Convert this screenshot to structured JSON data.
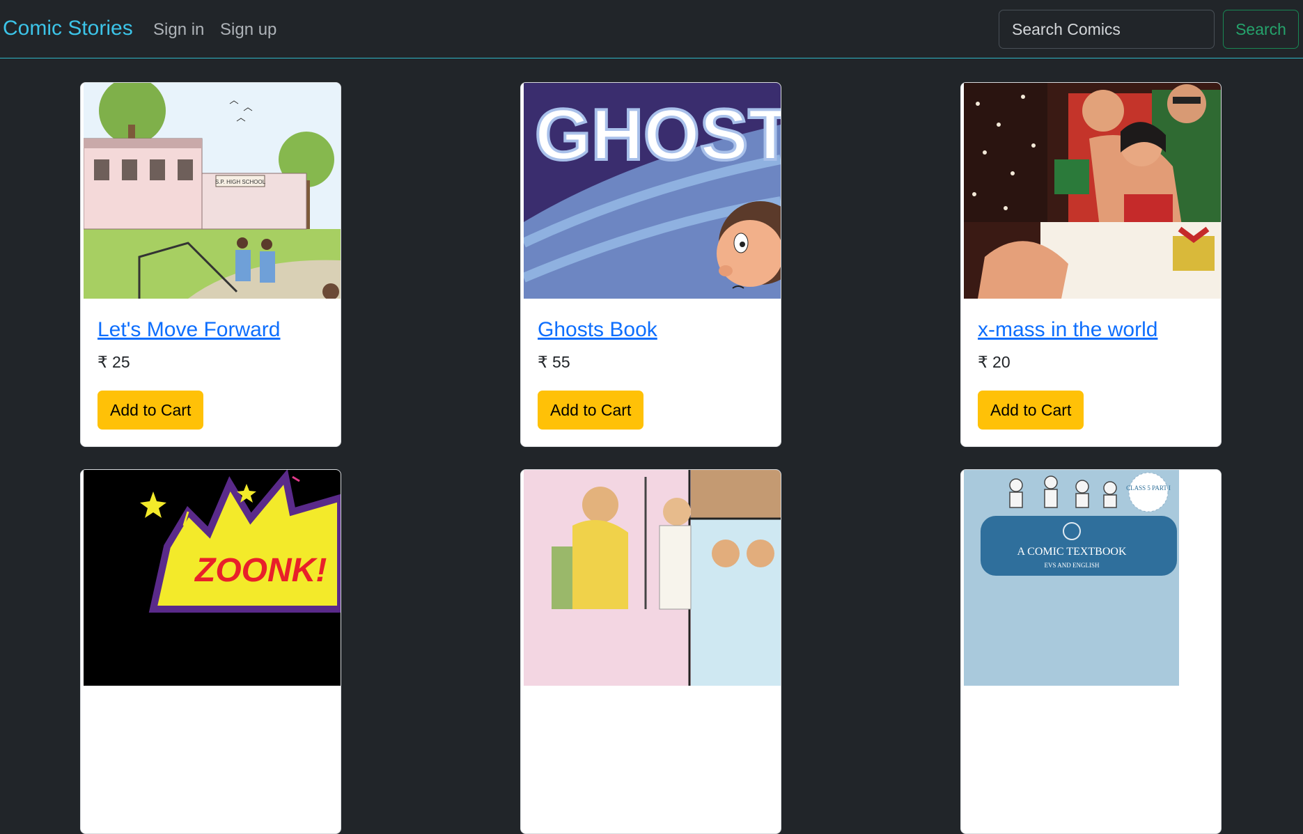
{
  "navbar": {
    "brand": "Comic Stories",
    "links": [
      "Sign in",
      "Sign up"
    ],
    "search_placeholder": "Search Comics",
    "search_button": "Search"
  },
  "cards": [
    {
      "title": "Let's Move Forward",
      "price": "₹ 25",
      "button": "Add to Cart",
      "image_text": "S.P. HIGH SCHOOL"
    },
    {
      "title": "Ghosts Book",
      "price": "₹ 55",
      "button": "Add to Cart",
      "image_text": "GHOST"
    },
    {
      "title": "x-mass in the world",
      "price": "₹ 20",
      "button": "Add to Cart"
    },
    {
      "image_text": "ZOONK!"
    },
    {},
    {
      "image_text": "A COMIC TEXTBOOK",
      "image_subtext": "EVS AND ENGLISH",
      "image_badge": "CLASS 5 PART I"
    }
  ]
}
